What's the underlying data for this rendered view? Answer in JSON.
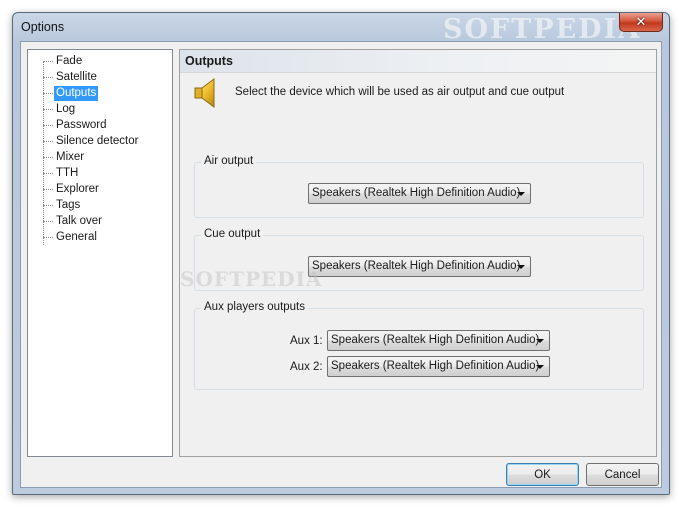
{
  "window": {
    "title": "Options",
    "watermark": "SOFTPEDIA",
    "close_icon": "close-icon",
    "close_glyph": "✕"
  },
  "tree": {
    "items": [
      {
        "label": "Fade"
      },
      {
        "label": "Satellite"
      },
      {
        "label": "Outputs",
        "selected": true
      },
      {
        "label": "Log"
      },
      {
        "label": "Password"
      },
      {
        "label": "Silence detector"
      },
      {
        "label": "Mixer"
      },
      {
        "label": "TTH"
      },
      {
        "label": "Explorer"
      },
      {
        "label": "Tags"
      },
      {
        "label": "Talk over"
      },
      {
        "label": "General"
      }
    ]
  },
  "panel": {
    "title": "Outputs",
    "icon": "speaker-icon",
    "description": "Select the device which will be used as air output and cue output",
    "watermark": "SOFTPEDIA",
    "air_output": {
      "label": "Air output",
      "value": "Speakers (Realtek High Definition Audio)"
    },
    "cue_output": {
      "label": "Cue output",
      "value": "Speakers (Realtek High Definition Audio)"
    },
    "aux_outputs": {
      "label": "Aux players outputs",
      "aux1_label": "Aux 1:",
      "aux1_value": "Speakers (Realtek High Definition Audio)",
      "aux2_label": "Aux 2:",
      "aux2_value": "Speakers (Realtek High Definition Audio)"
    }
  },
  "buttons": {
    "ok": "OK",
    "cancel": "Cancel"
  },
  "colors": {
    "selection": "#3399ff",
    "titlebar": "#b8c8dc",
    "close": "#c2381d"
  }
}
